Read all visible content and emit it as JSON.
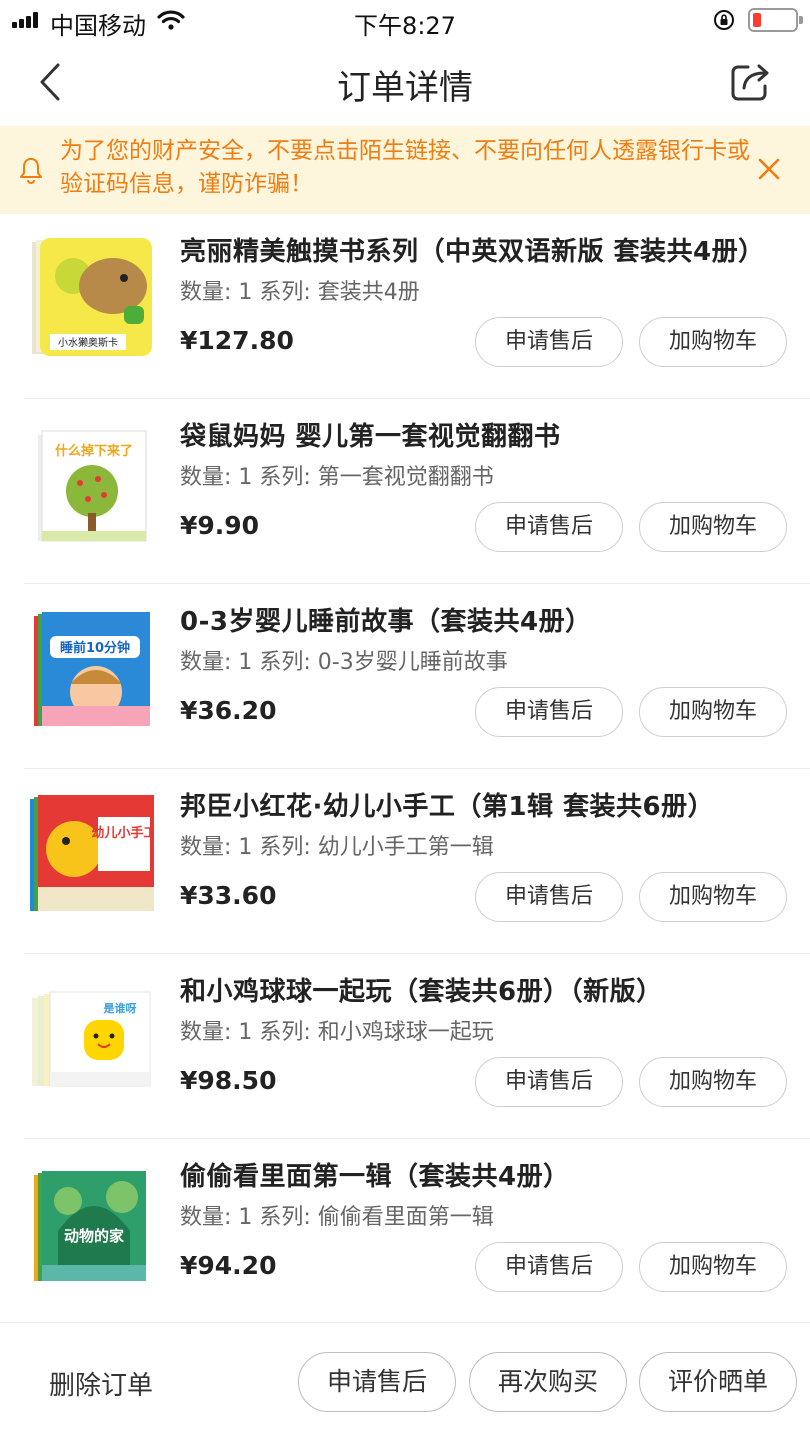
{
  "status_bar": {
    "carrier": "中国移动",
    "time": "下午8:27"
  },
  "nav": {
    "title": "订单详情"
  },
  "banner": {
    "text": "为了您的财产安全，不要点击陌生链接、不要向任何人透露银行卡或验证码信息，谨防诈骗！"
  },
  "actions": {
    "after_sale": "申请售后",
    "add_cart": "加购物车"
  },
  "items": [
    {
      "title": "亮丽精美触摸书系列（中英双语新版 套装共4册）",
      "meta": "数量: 1 系列: 套装共4册",
      "price": "¥127.80",
      "cover_text": "小水獭奥斯卡"
    },
    {
      "title": "袋鼠妈妈 婴儿第一套视觉翻翻书",
      "meta": "数量: 1 系列: 第一套视觉翻翻书",
      "price": "¥9.90",
      "cover_text": "什么掉下来了"
    },
    {
      "title": "0-3岁婴儿睡前故事（套装共4册）",
      "meta": "数量: 1 系列: 0-3岁婴儿睡前故事",
      "price": "¥36.20",
      "cover_text": "睡前10分钟"
    },
    {
      "title": "邦臣小红花·幼儿小手工（第1辑 套装共6册）",
      "meta": "数量: 1 系列: 幼儿小手工第一辑",
      "price": "¥33.60",
      "cover_text": "幼儿小手工"
    },
    {
      "title": "和小鸡球球一起玩（套装共6册）（新版）",
      "meta": "数量: 1 系列: 和小鸡球球一起玩",
      "price": "¥98.50",
      "cover_text": "是谁呀"
    },
    {
      "title": " 偷偷看里面第一辑（套装共4册）",
      "meta": "数量: 1 系列: 偷偷看里面第一辑",
      "price": "¥94.20",
      "cover_text": "动物的家"
    }
  ],
  "bottom": {
    "delete": "删除订单",
    "after_sale": "申请售后",
    "rebuy": "再次购买",
    "review": "评价晒单"
  },
  "colors": {
    "banner_bg": "#fdf5dc",
    "banner_text": "#f07d12",
    "battery_low": "#ff3b30"
  }
}
